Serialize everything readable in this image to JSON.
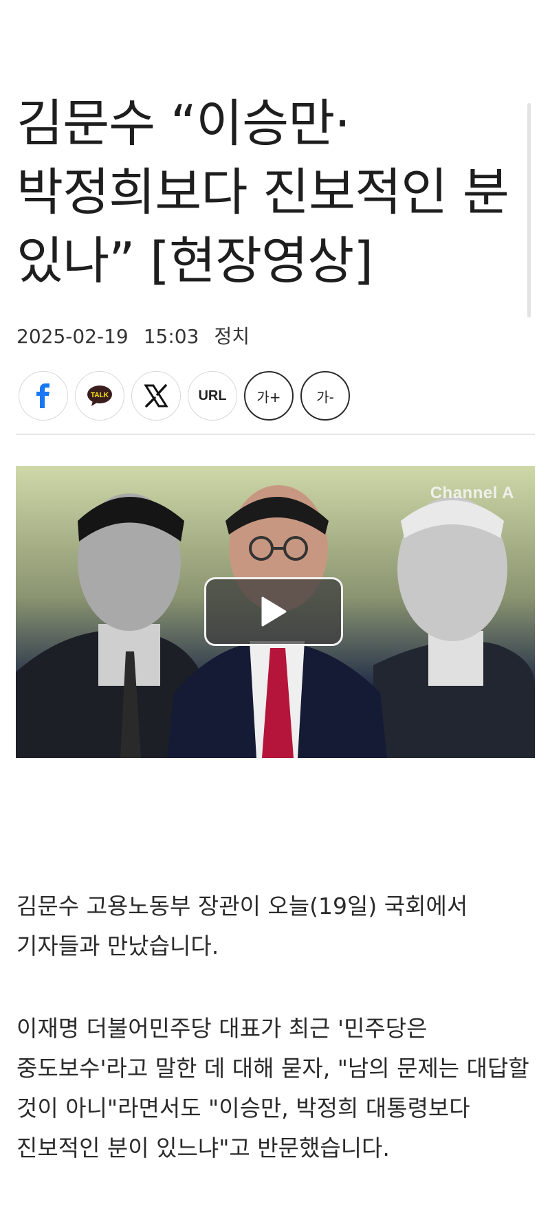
{
  "article": {
    "headline": "김문수 “이승만·박정희보다 진보적인 분 있나” [현장영상]",
    "date": "2025-02-19",
    "time": "15:03",
    "category": "정치"
  },
  "share": {
    "facebook_icon": "facebook-icon",
    "kakaotalk_label": "TALK",
    "x_icon": "x-icon",
    "url_label": "URL",
    "font_increase_label": "가+",
    "font_decrease_label": "가-"
  },
  "video": {
    "channel_logo": "Channel A",
    "play_icon": "play-icon"
  },
  "body": {
    "paragraphs": [
      "김문수 고용노동부 장관이 오늘(19일) 국회에서 기자들과 만났습니다.",
      "이재명 더불어민주당 대표가 최근 '민주당은 중도보수'라고 말한 데 대해 묻자, \"남의 문제는 대답할 것이 아니\"라면서도 \"이승만, 박정희 대통령보다 진보적인 분이 있느냐\"고 반문했습니다."
    ]
  },
  "colors": {
    "facebook": "#1877f2",
    "kakao_bubble": "#3a1d1d",
    "text": "#222222",
    "divider": "#e6e6e6"
  }
}
